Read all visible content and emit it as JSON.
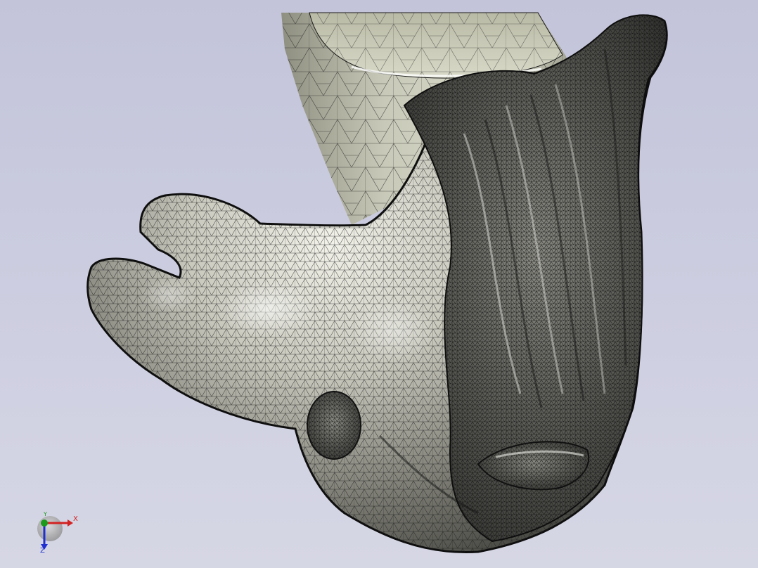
{
  "viewport": {
    "background_top": "#c3c4da",
    "background_bottom": "#d6d7e5",
    "display_mode": "shaded-with-edges"
  },
  "model": {
    "surface_light": "#e6e6da",
    "surface_mid": "#a9a99e",
    "surface_dark": "#3e3e3a",
    "mesh_line": "#1a1a1a",
    "pipe_fill": "#b9baa8"
  },
  "triad": {
    "x_label": "X",
    "y_label": "Y",
    "z_label": "Z",
    "x_color": "#d22222",
    "y_color": "#1b9a1b",
    "z_color": "#1f2fd0"
  }
}
